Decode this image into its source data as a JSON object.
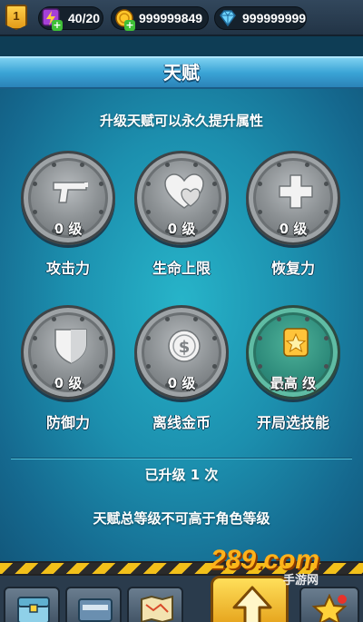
{
  "topbar": {
    "level": "1",
    "energy": "40/20",
    "coins": "999999849",
    "gems": "999999999"
  },
  "header": {
    "title": "天赋"
  },
  "panel": {
    "subtitle": "升级天赋可以永久提升属性",
    "talents": [
      {
        "icon": "pistol-icon",
        "level": "0 级",
        "name": "攻击力"
      },
      {
        "icon": "hearts-icon",
        "level": "0 级",
        "name": "生命上限"
      },
      {
        "icon": "cross-icon",
        "level": "0 级",
        "name": "恢复力"
      },
      {
        "icon": "shield-icon",
        "level": "0 级",
        "name": "防御力"
      },
      {
        "icon": "coin-icon",
        "level": "0 级",
        "name": "离线金币"
      },
      {
        "icon": "star-medal-icon",
        "level": "最高 级",
        "name": "开局选技能"
      }
    ],
    "upgraded_text": "已升级 1 次",
    "note": "天赋总等级不可高于角色等级"
  },
  "watermark": {
    "logo": "289.com",
    "site": "手游网"
  },
  "colors": {
    "accent": "#3ba4d6",
    "gold": "#f2c01a",
    "panel": "#1c8fae"
  }
}
